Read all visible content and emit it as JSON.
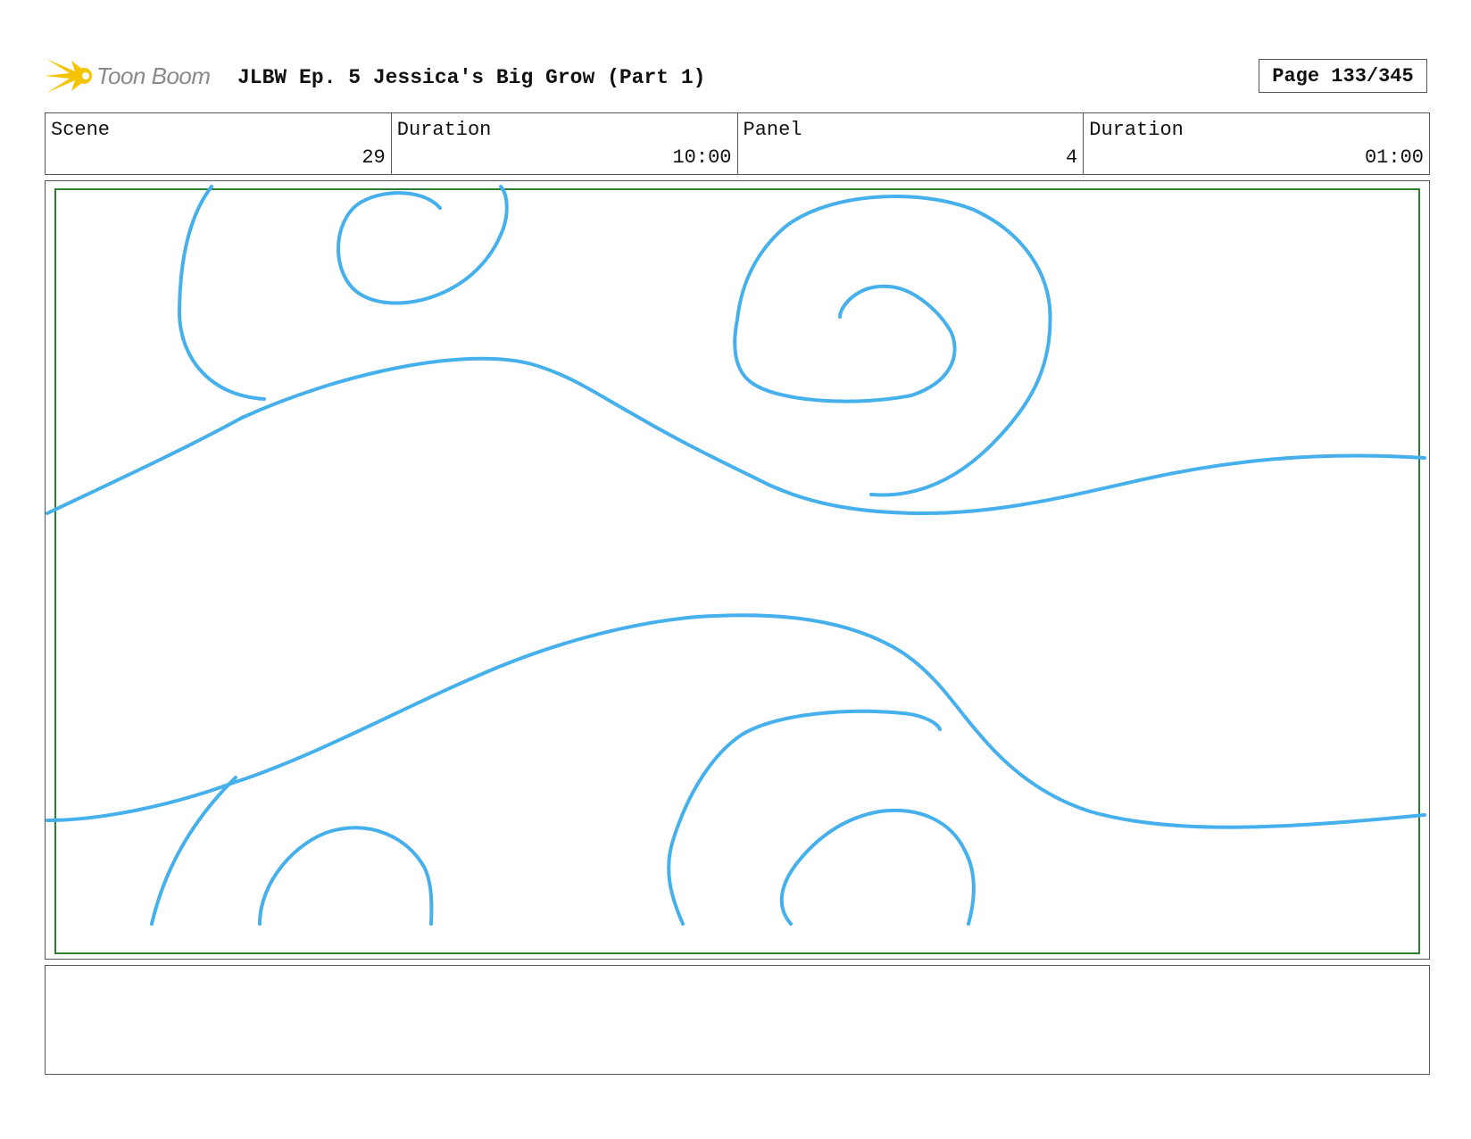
{
  "header": {
    "logo_text": "Toon Boom",
    "title": "JLBW Ep. 5 Jessica's Big Grow (Part 1)",
    "page": "Page 133/345"
  },
  "info": {
    "scene_label": "Scene",
    "scene_value": "29",
    "scene_duration_label": "Duration",
    "scene_duration_value": "10:00",
    "panel_label": "Panel",
    "panel_value": "4",
    "panel_duration_label": "Duration",
    "panel_duration_value": "01:00"
  },
  "colors": {
    "sketch_stroke": "#45b0ec",
    "safe_area": "#2e7d32",
    "logo_star": "#f5c400"
  },
  "icons": {
    "logo": "toon-boom-star-icon"
  }
}
